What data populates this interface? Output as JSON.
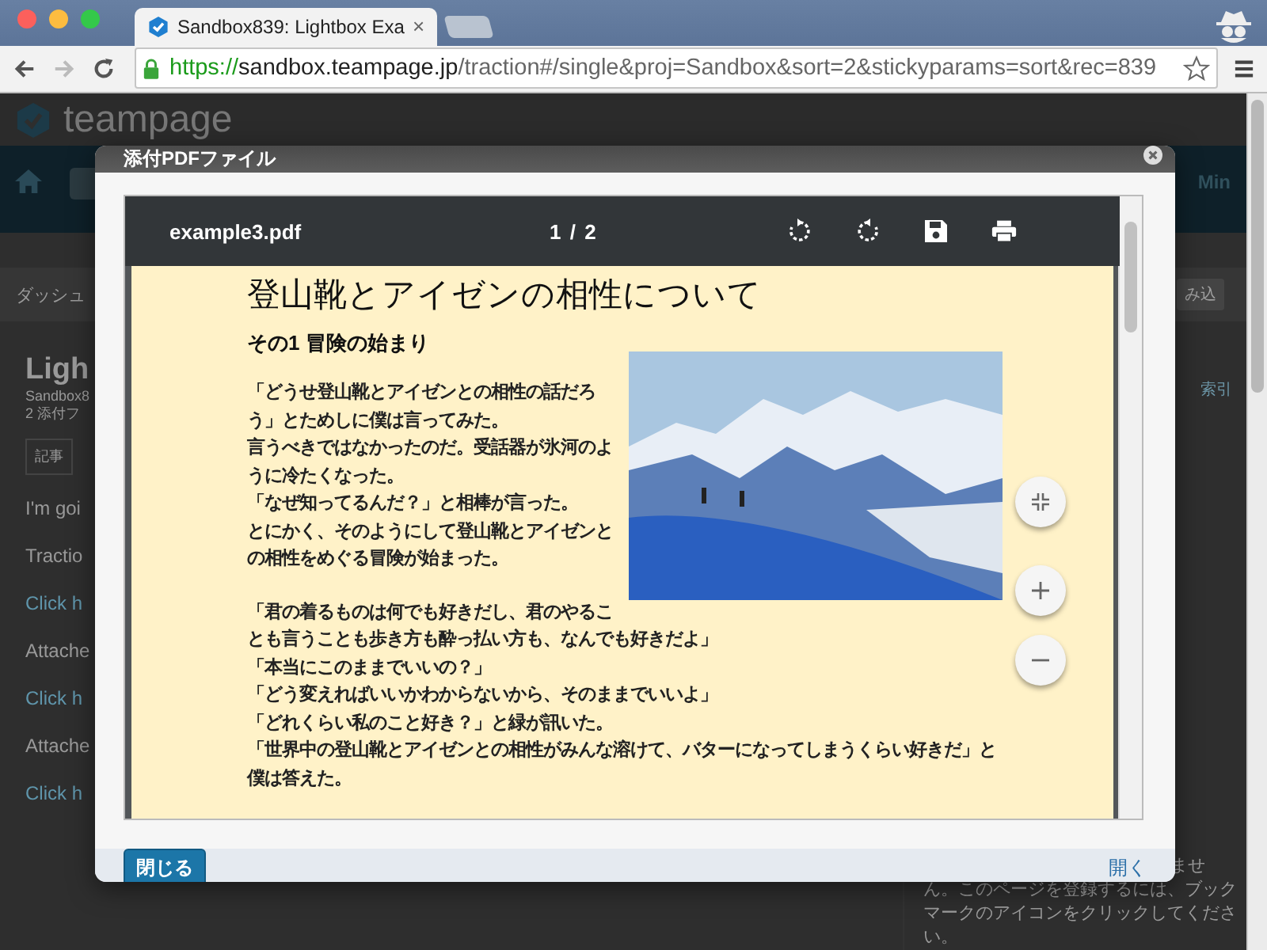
{
  "browser": {
    "tab": {
      "title": "Sandbox839: Lightbox Exa",
      "close": "×"
    },
    "url": {
      "scheme": "https://",
      "host": "sandbox.teampage.jp",
      "path": "/traction#/single&proj=Sandbox&sort=2&stickyparams=sort&rec=839"
    }
  },
  "background_page": {
    "logo": "teampage",
    "nav_user": "Min",
    "breadcrumb": "ダッシュ",
    "action": "み込",
    "title": "Ligh",
    "meta": [
      "Sandbox8",
      "2 添付フ"
    ],
    "tab": "記事",
    "lines": [
      {
        "kind": "text",
        "text": "I'm goi"
      },
      {
        "kind": "text",
        "text": "Tractio"
      },
      {
        "kind": "link",
        "text": "Click h"
      },
      {
        "kind": "text",
        "text": "Attache"
      },
      {
        "kind": "link",
        "text": "Click h"
      },
      {
        "kind": "text",
        "text": "Attache"
      },
      {
        "kind": "link",
        "text": "Click h"
      }
    ],
    "sidebar": {
      "link": "索引",
      "note": [
        "ませ",
        "ん。このページを登録するには、ブック",
        "マークのアイコンをクリックしてくださ",
        "い。"
      ]
    }
  },
  "modal": {
    "title": "添付PDFファイル",
    "viewer": {
      "filename": "example3.pdf",
      "page": "1",
      "total": "2",
      "separator": "/"
    },
    "document": {
      "title": "登山靴とアイゼンの相性について",
      "heading": "その1 冒険の始まり",
      "paragraphs": [
        [
          "「どうせ登山靴とアイゼンとの相性の話だろう」とためしに僕は言ってみた。",
          "言うべきではなかったのだ。受話器が氷河のように冷たくなった。",
          "「なぜ知ってるんだ？」と相棒が言った。",
          "とにかく、そのようにして登山靴とアイゼンとの相性をめぐる冒険が始まった。"
        ],
        [
          "「君の着るものは何でも好きだし、君のやることも言うことも歩き方も酔っ払い方も、なんでも好きだよ」",
          "「本当にこのままでいいの？」",
          "「どう変えればいいかわからないから、そのままでいいよ」",
          "「どれくらい私のこと好き？」と緑が訊いた。",
          "「世界中の登山靴とアイゼンとの相性がみんな溶けて、バターになってしまうくらい好きだ」と僕は答えた。"
        ]
      ]
    },
    "footer": {
      "close_button": "閉じる",
      "open_link": "開く"
    }
  }
}
